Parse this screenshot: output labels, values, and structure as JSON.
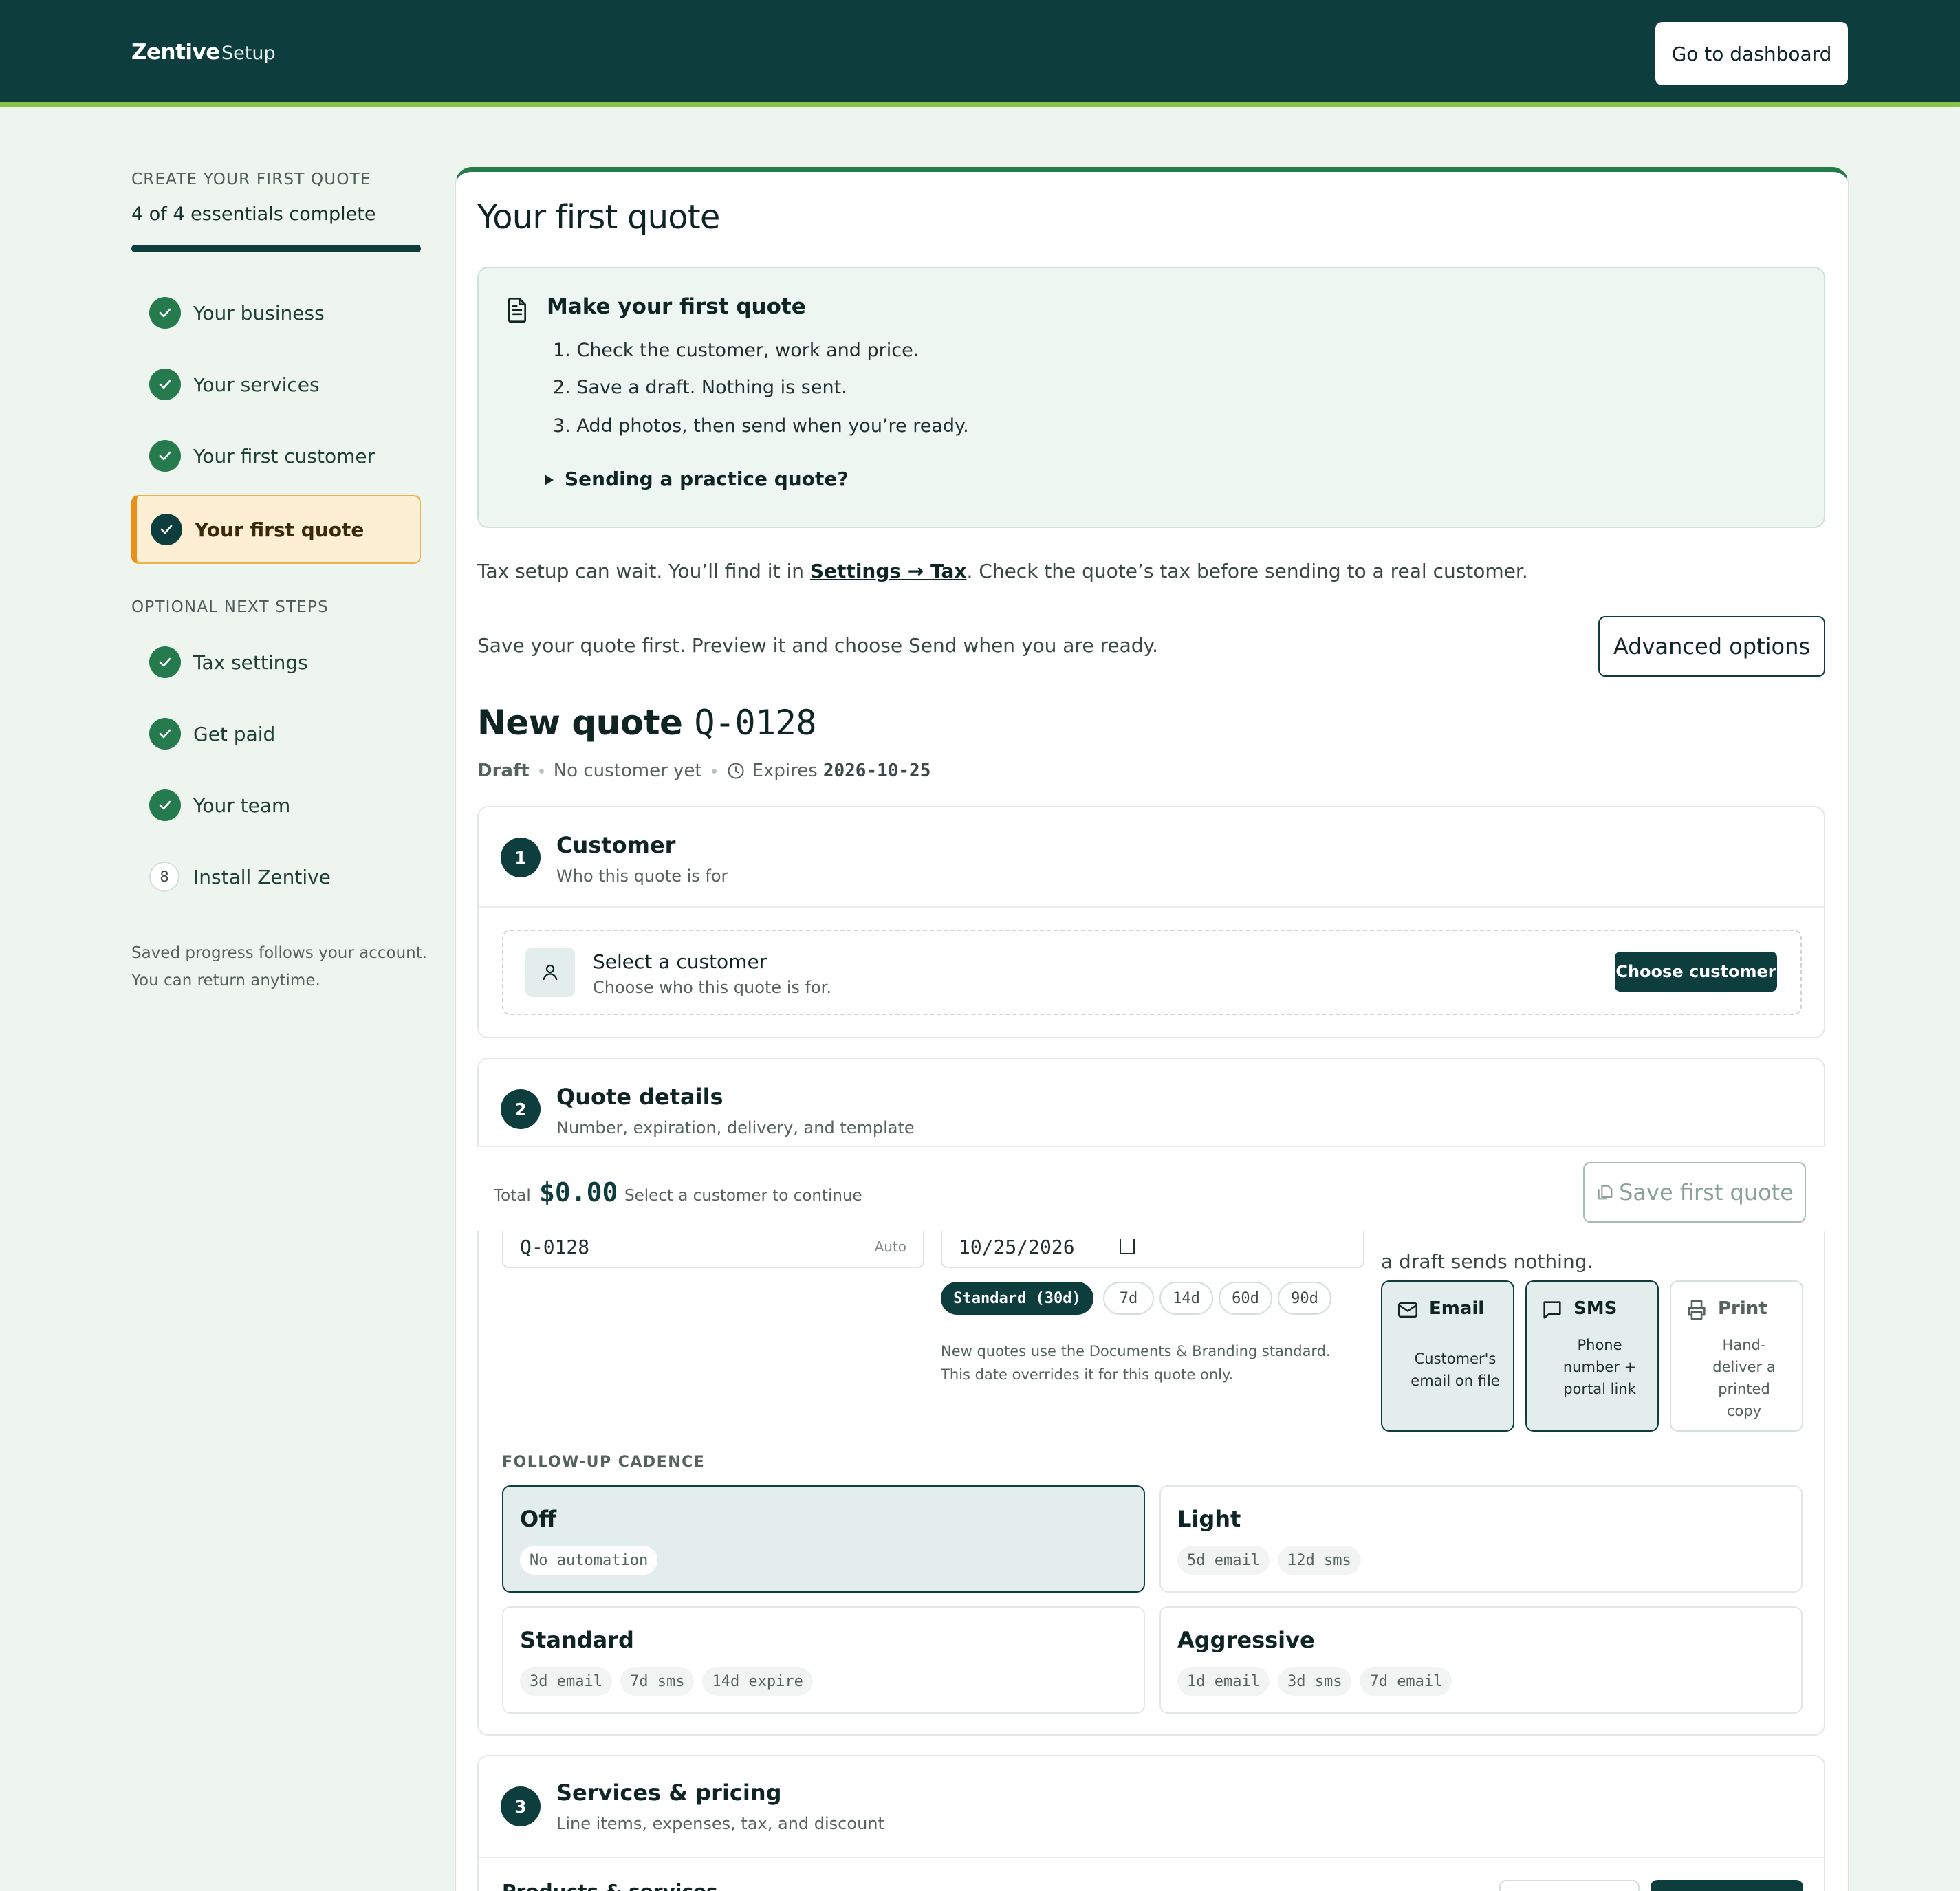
{
  "header": {
    "brand": "Zentive",
    "section": "Setup",
    "dashboard_button": "Go to dashboard"
  },
  "sidebar": {
    "caption": "CREATE YOUR FIRST QUOTE",
    "progress_text": "4 of 4 essentials complete",
    "progress_fraction": 1.0,
    "essentials": [
      {
        "label": "Your business",
        "status": "done"
      },
      {
        "label": "Your services",
        "status": "done"
      },
      {
        "label": "Your first customer",
        "status": "done"
      },
      {
        "label": "Your first quote",
        "status": "active"
      }
    ],
    "optional_caption": "OPTIONAL NEXT STEPS",
    "optional": [
      {
        "label": "Tax settings",
        "status": "done"
      },
      {
        "label": "Get paid",
        "status": "done"
      },
      {
        "label": "Your team",
        "status": "done"
      },
      {
        "label": "Install Zentive",
        "status": "todo",
        "number": "8"
      }
    ],
    "note": "Saved progress follows your account. You can return anytime."
  },
  "main": {
    "title": "Your first quote",
    "tip": {
      "title": "Make your first quote",
      "steps": [
        "1. Check the customer, work and price.",
        "2. Save a draft. Nothing is sent.",
        "3. Add photos, then send when you’re ready."
      ],
      "details": "Sending a practice quote?"
    },
    "tax": {
      "before": "Tax setup can wait. You’ll find it in ",
      "link": "Settings → Tax",
      "after": ". Check the quote’s tax before sending to a real customer."
    },
    "save_hint": "Save your quote first. Preview it and choose Send when you are ready.",
    "advanced_button": "Advanced options",
    "quote": {
      "title_prefix": "New quote",
      "number": "Q-0128",
      "status": "Draft",
      "customer_state": "No customer yet",
      "expires_label": "Expires",
      "expires_date": "2026-10-25"
    },
    "sections": {
      "customer": {
        "step": "1",
        "title": "Customer",
        "subtitle": "Who this quote is for",
        "select_title": "Select a customer",
        "select_sub": "Choose who this quote is for.",
        "choose_button": "Choose customer"
      },
      "details": {
        "step": "2",
        "title": "Quote details",
        "subtitle": "Number, expiration, delivery, and template",
        "number_value": "Q-0128",
        "number_hint": "Auto",
        "expiry_value": "10/25/2026",
        "expiry_presets": [
          {
            "label": "Standard (30d)",
            "selected": true
          },
          {
            "label": "7d",
            "selected": false
          },
          {
            "label": "14d",
            "selected": false
          },
          {
            "label": "60d",
            "selected": false
          },
          {
            "label": "90d",
            "selected": false
          }
        ],
        "expiry_note": "New quotes use the Documents & Branding standard. This date overrides it for this quote only.",
        "delivery_text": "a draft sends nothing.",
        "delivery": [
          {
            "name": "Email",
            "desc": "Customer's email on file",
            "selected": true,
            "icon": "mail-icon"
          },
          {
            "name": "SMS",
            "desc": "Phone number + portal link",
            "selected": true,
            "icon": "chat-icon"
          },
          {
            "name": "Print",
            "desc": "Hand-deliver a printed copy",
            "selected": false,
            "icon": "printer-icon"
          }
        ],
        "cadence_caption": "FOLLOW-UP CADENCE",
        "cadence": [
          {
            "name": "Off",
            "tags": [
              "No automation"
            ],
            "selected": true
          },
          {
            "name": "Light",
            "tags": [
              "5d email",
              "12d sms"
            ],
            "selected": false
          },
          {
            "name": "Standard",
            "tags": [
              "3d email",
              "7d sms",
              "14d expire"
            ],
            "selected": false
          },
          {
            "name": "Aggressive",
            "tags": [
              "1d email",
              "3d sms",
              "7d email"
            ],
            "selected": false
          }
        ]
      },
      "services": {
        "step": "3",
        "title": "Services & pricing",
        "subtitle": "Line items, expenses, tax, and discount",
        "products_label": "Products & services"
      }
    },
    "footer": {
      "total_label": "Total",
      "total_value": "$0.00",
      "hint": "Select a customer to continue",
      "save_button": "Save first quote"
    }
  },
  "colors": {
    "brand_dark": "#0d3d3d",
    "accent_green": "#257a4e",
    "lime": "#8bc34a",
    "active_orange": "#e8901a"
  }
}
